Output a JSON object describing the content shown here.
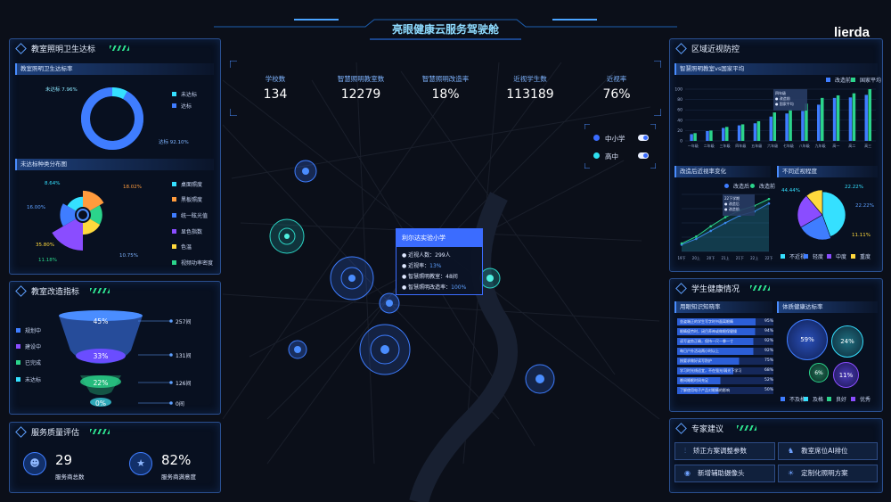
{
  "header": {
    "title": "亮眼健康云服务驾驶舱",
    "logo": "lierda"
  },
  "kpis": [
    {
      "label": "学校数",
      "value": "134"
    },
    {
      "label": "智慧照明教室数",
      "value": "12279"
    },
    {
      "label": "智慧照明改造率",
      "value": "18%"
    },
    {
      "label": "近视学生数",
      "value": "113189"
    },
    {
      "label": "近视率",
      "value": "76%"
    }
  ],
  "filters": [
    {
      "label": "中小学",
      "color": "#3b6cff"
    },
    {
      "label": "高中",
      "color": "#2ee0f0"
    }
  ],
  "tooltip": {
    "title": "利尔达实验小学",
    "rows": [
      {
        "label": "近视人数：",
        "value": "299人"
      },
      {
        "label": "近视率：",
        "value": "13%"
      },
      {
        "label": "智慧照明教室：",
        "value": "48间"
      },
      {
        "label": "智慧照明改造率：",
        "value": "100%"
      }
    ]
  },
  "p_lighting": {
    "title": "教室照明卫生达标",
    "sub1": "教室照明卫生达标率",
    "donut": {
      "unqual_label": "未达标 7.96%",
      "qual_label": "达标 92.10%",
      "legend": [
        "未达标",
        "达标"
      ]
    },
    "sub2": "未达标种类分布图",
    "rose": {
      "labels": [
        "8.64%",
        "18.02%",
        "16.00%",
        "35.80%",
        "11.18%",
        "10.75%"
      ],
      "legend": [
        "桌面照度",
        "黑板照度",
        "统一眩光值",
        "显色指数",
        "色温",
        "视频功率密度"
      ]
    }
  },
  "p_reform": {
    "title": "教室改造指标",
    "legend": [
      "规划中",
      "建设中",
      "已完成",
      "未达标"
    ],
    "funnel": [
      "45%",
      "33%",
      "22%",
      "0%"
    ],
    "counts": [
      "257间",
      "131间",
      "126间",
      "0间"
    ]
  },
  "p_service": {
    "title": "服务质量评估",
    "a_value": "29",
    "a_label": "服务商总数",
    "b_value": "82%",
    "b_label": "服务商满意度"
  },
  "p_myopia": {
    "title": "区域近视防控",
    "sub1": "智慧照明教室vs国家平均",
    "legend1": [
      "改造前",
      "国家平均"
    ],
    "yticks": [
      "100",
      "80",
      "60",
      "40",
      "20",
      "0"
    ],
    "categories": [
      "一年级",
      "二年级",
      "三年级",
      "四年级",
      "五年级",
      "六年级",
      "七年级",
      "八年级",
      "九年级",
      "高一",
      "高二",
      "高三"
    ],
    "tip": {
      "title": "四年级",
      "rows": [
        "改造前",
        "国家平均"
      ]
    },
    "sub2": "改造后近视率变化",
    "legend2": [
      "改造后",
      "改造前"
    ],
    "line_tip": {
      "title": "22下学期",
      "rows": [
        "改造后",
        "改造前"
      ]
    },
    "sub3": "不同近视程度",
    "legend3": [
      "不近视",
      "轻度",
      "中度",
      "重度"
    ],
    "pie_labels": [
      "44.44%",
      "22.22%",
      "22.22%",
      "11.11%"
    ]
  },
  "p_health": {
    "title": "学生健康情况",
    "sub1": "用眼知识知晓率",
    "rows": [
      {
        "label": "坐姿端正的学生写字时书面离眼睛",
        "value": "95%"
      },
      {
        "label": "眼睛疲劳时，闭目养神或做眼保健操",
        "value": "94%"
      },
      {
        "label": "读写姿势正确，保持一尺一拳一寸",
        "value": "92%"
      },
      {
        "label": "每日户外活动两小时以上",
        "value": "92%"
      },
      {
        "label": "按要求做好读写防护",
        "value": "75%"
      },
      {
        "label": "学习时光线适宜，不在强光/弱光下学习",
        "value": "68%"
      },
      {
        "label": "晚间睡眠时间充足",
        "value": "52%"
      },
      {
        "label": "了解使用电子产品对眼睛的影响",
        "value": "50%"
      }
    ],
    "sub2": "体质健康达标率",
    "bubbles": [
      "59%",
      "24%",
      "6%",
      "11%"
    ],
    "legend": [
      "不及格",
      "及格",
      "良好",
      "优秀"
    ]
  },
  "p_advice": {
    "title": "专家建议",
    "buttons": [
      "矫正方案调整参数",
      "教室席位AI排位",
      "新增辅助摄像头",
      "定制化照明方案"
    ]
  },
  "chart_data": [
    {
      "type": "pie",
      "title": "教室照明卫生达标率",
      "labels": [
        "未达标",
        "达标"
      ],
      "values": [
        7.96,
        92.1
      ]
    },
    {
      "type": "pie",
      "title": "未达标种类分布图",
      "labels": [
        "桌面照度",
        "黑板照度",
        "统一眩光值",
        "显色指数",
        "色温",
        "视频功率密度"
      ],
      "values": [
        8.64,
        18.02,
        16.0,
        35.8,
        11.18,
        10.75
      ]
    },
    {
      "type": "bar",
      "title": "智慧照明教室vs国家平均",
      "categories": [
        "一年级",
        "二年级",
        "三年级",
        "四年级",
        "五年级",
        "六年级",
        "七年级",
        "八年级",
        "九年级",
        "高一",
        "高二",
        "高三"
      ],
      "series": [
        {
          "name": "改造前",
          "values": [
            13,
            19,
            25,
            30,
            34,
            47,
            53,
            58,
            70,
            83,
            84,
            89
          ]
        },
        {
          "name": "国家平均",
          "values": [
            15,
            20,
            27,
            32,
            38,
            55,
            61,
            72,
            83,
            88,
            92,
            100
          ]
        }
      ],
      "ylim": [
        0,
        100
      ]
    },
    {
      "type": "line",
      "title": "改造后近视率变化",
      "x": [
        "19下",
        "20上",
        "20下",
        "21上",
        "21下",
        "22上",
        "22下"
      ],
      "series": [
        {
          "name": "改造后",
          "values": [
            12,
            22,
            36,
            50,
            63,
            70,
            84
          ]
        },
        {
          "name": "改造前",
          "values": [
            14,
            26,
            44,
            60,
            72,
            80,
            92
          ]
        }
      ],
      "ylim": [
        0,
        100
      ]
    },
    {
      "type": "pie",
      "title": "不同近视程度",
      "labels": [
        "不近视",
        "轻度",
        "中度",
        "重度"
      ],
      "values": [
        44.44,
        22.22,
        22.22,
        11.11
      ]
    }
  ]
}
